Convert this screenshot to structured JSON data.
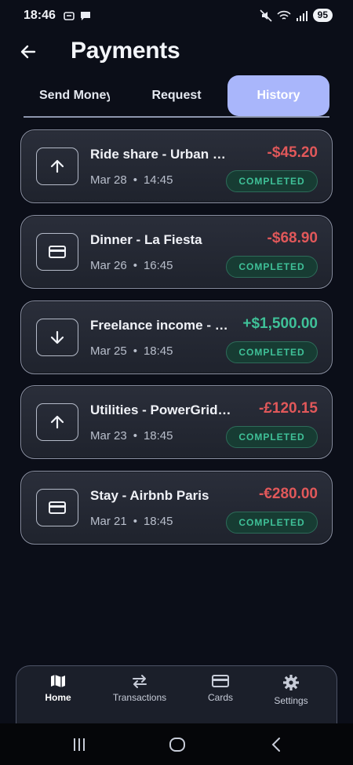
{
  "status_bar": {
    "time": "18:46",
    "battery": "95"
  },
  "header": {
    "title": "Payments"
  },
  "tabs": [
    {
      "label": "Send Money"
    },
    {
      "label": "Request"
    },
    {
      "label": "History"
    }
  ],
  "transactions": [
    {
      "name": "Ride share - Urban Ride",
      "date": "Mar 28",
      "time": "14:45",
      "amount": "-$45.20",
      "status": "COMPLETED",
      "icon": "arrow-up-icon"
    },
    {
      "name": "Dinner - La Fiesta",
      "date": "Mar 26",
      "time": "16:45",
      "amount": "-$68.90",
      "status": "COMPLETED",
      "icon": "card-icon"
    },
    {
      "name": "Freelance income - Project",
      "date": "Mar 25",
      "time": "18:45",
      "amount": "+$1,500.00",
      "status": "COMPLETED",
      "icon": "arrow-down-icon"
    },
    {
      "name": "Utilities - PowerGrid Co",
      "date": "Mar 23",
      "time": "18:45",
      "amount": "-£120.15",
      "status": "COMPLETED",
      "icon": "arrow-up-icon"
    },
    {
      "name": "Stay - Airbnb Paris",
      "date": "Mar 21",
      "time": "18:45",
      "amount": "-€280.00",
      "status": "COMPLETED",
      "icon": "card-icon"
    }
  ],
  "meta_separator": "•",
  "bottom_nav": [
    {
      "label": "Home",
      "icon": "map-icon"
    },
    {
      "label": "Transactions",
      "icon": "swap-arrows-icon"
    },
    {
      "label": "Cards",
      "icon": "card-icon"
    },
    {
      "label": "Settings",
      "icon": "gear-icon"
    }
  ],
  "colors": {
    "background": "#0b0e18",
    "accent_tab": "#a9b6fb",
    "negative": "#e1585a",
    "positive": "#3fc198"
  }
}
